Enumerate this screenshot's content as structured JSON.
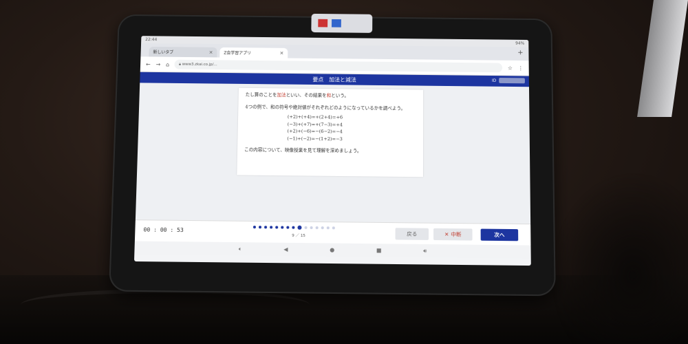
{
  "status_bar": {
    "time": "22:44",
    "battery": "94%"
  },
  "browser": {
    "tabs": [
      {
        "label": "新しいタブ",
        "active": false
      },
      {
        "label": "Z会学習アプリ",
        "active": true
      }
    ],
    "new_tab_icon": "plus-icon",
    "url": "www3.zkai.co.jp/..."
  },
  "app_header": {
    "section": "要点",
    "title": "加法と減法",
    "id_label": "ID"
  },
  "lesson": {
    "line1_a": "たし算のことを",
    "line1_hl1": "加法",
    "line1_b": "といい、その結果を",
    "line1_hl2": "和",
    "line1_c": "という。",
    "line2": "4つの例で、和の符号や絶対値がそれぞれどのようになっているかを調べよう。",
    "equations": [
      "(+2)+(+4)=+(2+4)=+6",
      "(−3)+(+7)=+(7−3)=+4",
      "(+2)+(−6)=−(6−2)=−4",
      "(−1)+(−2)=−(1+2)=−3"
    ],
    "footer": "この内容について、映像授業を見て理解を深めましょう。"
  },
  "bottom_bar": {
    "timer": "00 : 00 : 53",
    "progress": {
      "current": 9,
      "total": 15,
      "label": "9 ／ 15"
    },
    "back_label": "戻る",
    "stop_label": "中断",
    "next_label": "次へ"
  },
  "colors": {
    "brand": "#1d35a0",
    "highlight": "#c0392b"
  }
}
